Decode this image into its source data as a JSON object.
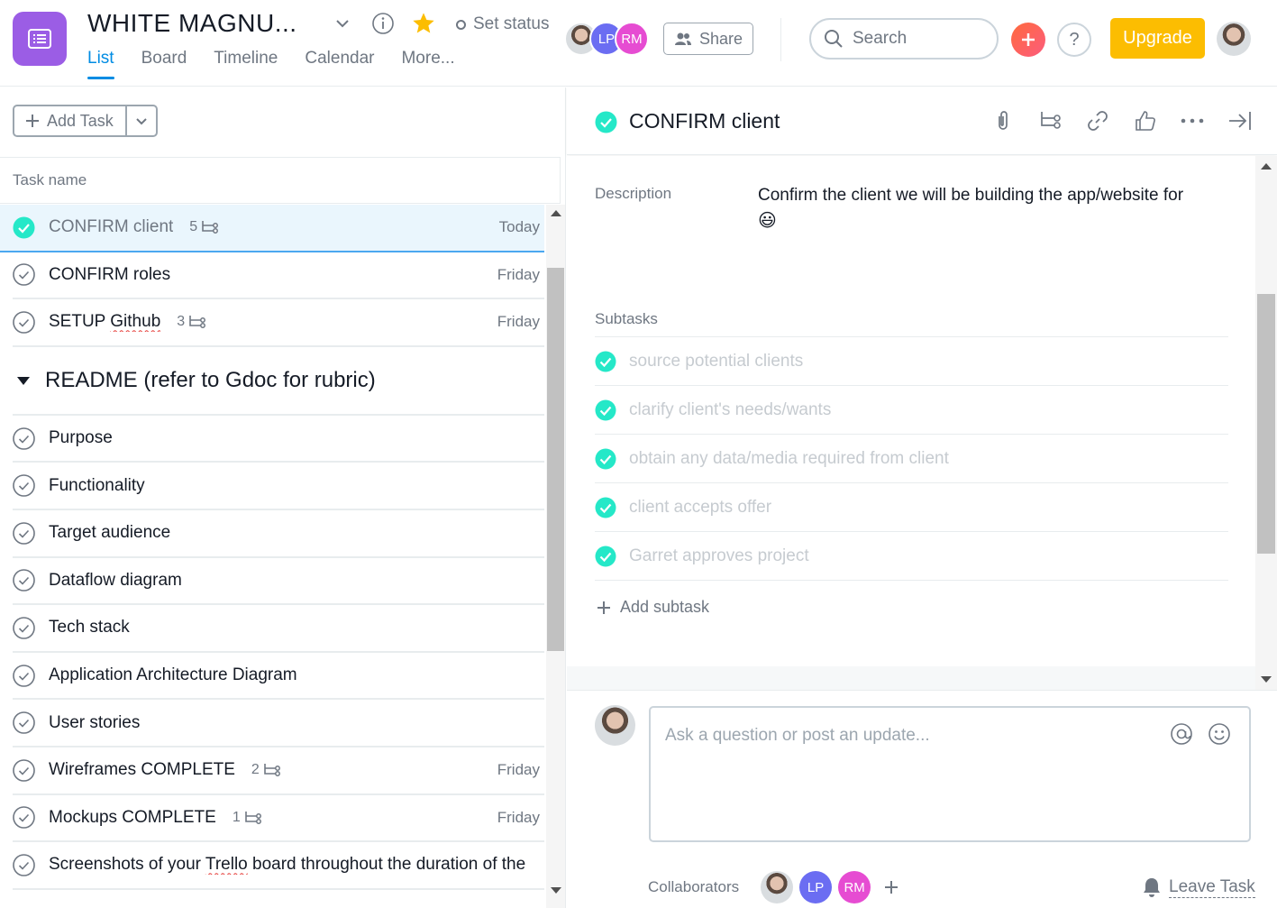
{
  "header": {
    "project_title": "WHITE MAGNU...",
    "set_status": "Set status",
    "tabs": [
      "List",
      "Board",
      "Timeline",
      "Calendar",
      "More..."
    ],
    "active_tab": "List",
    "members": [
      {
        "type": "photo",
        "initials": ""
      },
      {
        "type": "initials",
        "initials": "LP",
        "color": "#6b6df2"
      },
      {
        "type": "initials",
        "initials": "RM",
        "color": "#e64cd2"
      }
    ],
    "share_label": "Share",
    "search_placeholder": "Search",
    "help_label": "?",
    "upgrade_label": "Upgrade",
    "colors": {
      "accent": "#008ce3",
      "upgrade": "#fcbd01",
      "brand": "#9b5de5",
      "check": "#25e8c8"
    }
  },
  "task_list": {
    "add_task_label": "Add Task",
    "column_header": "Task name",
    "tasks_top": [
      {
        "name": "CONFIRM client",
        "subtask_count": "5",
        "due": "Today",
        "completed": true,
        "selected": true
      },
      {
        "name": "CONFIRM roles",
        "subtask_count": "",
        "due": "Friday",
        "completed": false
      },
      {
        "name": "SETUP Github",
        "subtask_count": "3",
        "due": "Friday",
        "completed": false
      }
    ],
    "section_title": "README (refer to Gdoc for rubric)",
    "tasks_section": [
      {
        "name": "Purpose",
        "subtask_count": "",
        "due": ""
      },
      {
        "name": "Functionality",
        "subtask_count": "",
        "due": ""
      },
      {
        "name": "Target audience",
        "subtask_count": "",
        "due": ""
      },
      {
        "name": "Dataflow diagram",
        "subtask_count": "",
        "due": ""
      },
      {
        "name": "Tech stack",
        "subtask_count": "",
        "due": ""
      },
      {
        "name": "Application Architecture Diagram",
        "subtask_count": "",
        "due": ""
      },
      {
        "name": "User stories",
        "subtask_count": "",
        "due": ""
      },
      {
        "name": "Wireframes COMPLETE",
        "subtask_count": "2",
        "due": "Friday"
      },
      {
        "name": "Mockups COMPLETE",
        "subtask_count": "1",
        "due": "Friday"
      },
      {
        "name": "Screenshots of your Trello board throughout the duration of the",
        "subtask_count": "",
        "due": ""
      }
    ]
  },
  "task_detail": {
    "title": "CONFIRM client",
    "description_label": "Description",
    "description": "Confirm the client we will be building the app/website for",
    "description_emoji": "😃",
    "subtasks_label": "Subtasks",
    "subtasks": [
      "source potential clients",
      "clarify client's needs/wants",
      "obtain any data/media required from client",
      "client accepts offer",
      "Garret approves project"
    ],
    "add_subtask_label": "Add subtask",
    "comment_placeholder": "Ask a question or post an update...",
    "collaborators_label": "Collaborators",
    "collaborators": [
      {
        "type": "photo",
        "initials": ""
      },
      {
        "type": "initials",
        "initials": "LP",
        "color": "#6b6df2"
      },
      {
        "type": "initials",
        "initials": "RM",
        "color": "#e64cd2"
      }
    ],
    "leave_task_label": "Leave Task",
    "toolbar_icons": [
      "paperclip-icon",
      "subtask-icon",
      "link-icon",
      "like-icon",
      "more-icon",
      "close-pane-icon"
    ]
  }
}
